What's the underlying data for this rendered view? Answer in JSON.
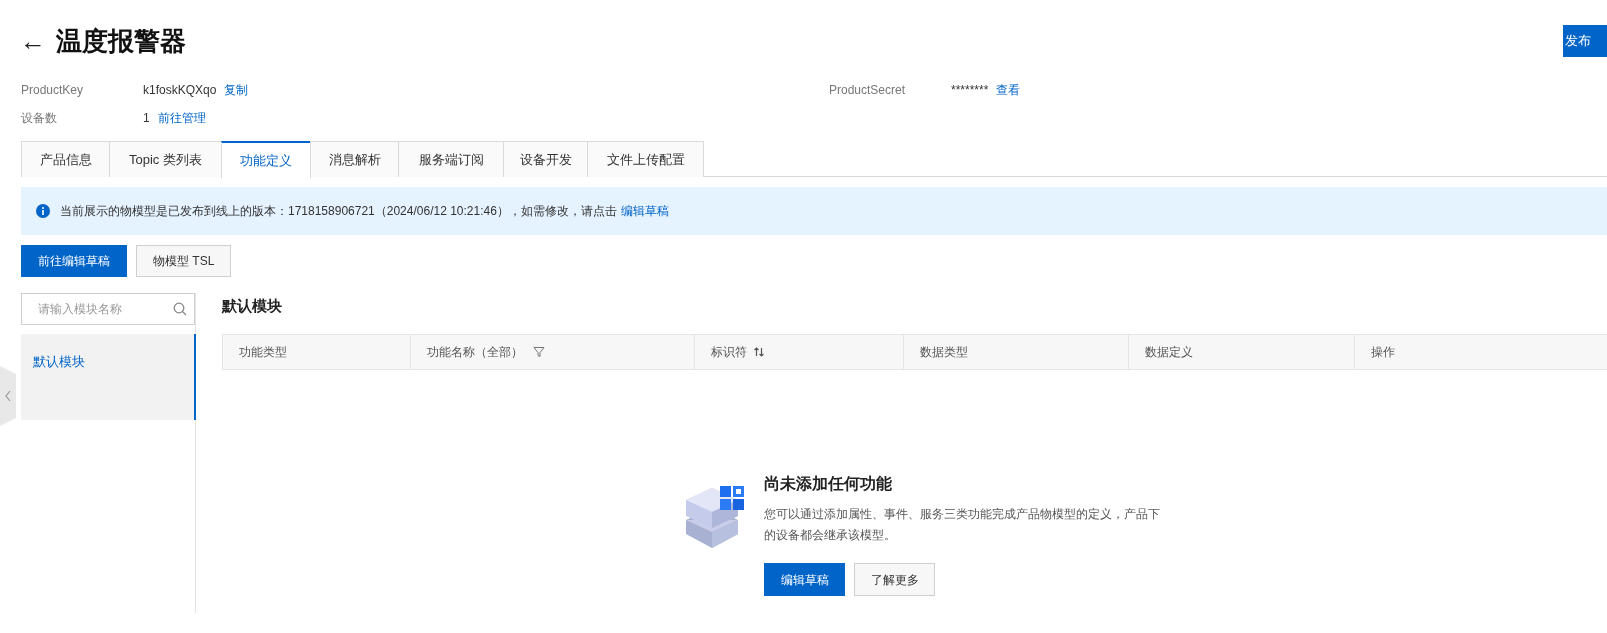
{
  "header": {
    "back": "←",
    "title": "温度报警器",
    "publish_button": "发布"
  },
  "info": [
    {
      "label": "ProductKey",
      "value": "k1foskKQXqo",
      "link": "复制"
    },
    {
      "label": "ProductSecret",
      "value": "********",
      "link": "查看"
    },
    {
      "label": "设备数",
      "value": "1",
      "link": "前往管理"
    }
  ],
  "tabs": [
    {
      "label": "产品信息",
      "selected": false
    },
    {
      "label": "Topic 类列表",
      "selected": false
    },
    {
      "label": "功能定义",
      "selected": true
    },
    {
      "label": "消息解析",
      "selected": false
    },
    {
      "label": "服务端订阅",
      "selected": false
    },
    {
      "label": "设备开发",
      "selected": false
    },
    {
      "label": "文件上传配置",
      "selected": false
    }
  ],
  "notice": {
    "text": "当前展示的物模型是已发布到线上的版本：1718158906721（2024/06/12 10:21:46），如需修改，请点击",
    "link": "编辑草稿"
  },
  "actions": [
    "前往编辑草稿",
    "物模型 TSL"
  ],
  "module_search": {
    "placeholder": "请输入模块名称"
  },
  "modules": [
    {
      "label": "默认模块",
      "selected": true
    }
  ],
  "module_title": "默认模块",
  "table": {
    "columns": [
      {
        "label": "功能类型",
        "kind": "plain"
      },
      {
        "label": "功能名称（全部）",
        "kind": "filter"
      },
      {
        "label": "标识符",
        "kind": "sort"
      },
      {
        "label": "数据类型",
        "kind": "plain"
      },
      {
        "label": "数据定义",
        "kind": "plain"
      },
      {
        "label": "操作",
        "kind": "plain"
      }
    ]
  },
  "empty_state": {
    "title": "尚未添加任何功能",
    "description": "您可以通过添加属性、事件、服务三类功能完成产品物模型的定义，产品下的设备都会继承该模型。",
    "buttons": [
      "编辑草稿",
      "了解更多"
    ]
  }
}
